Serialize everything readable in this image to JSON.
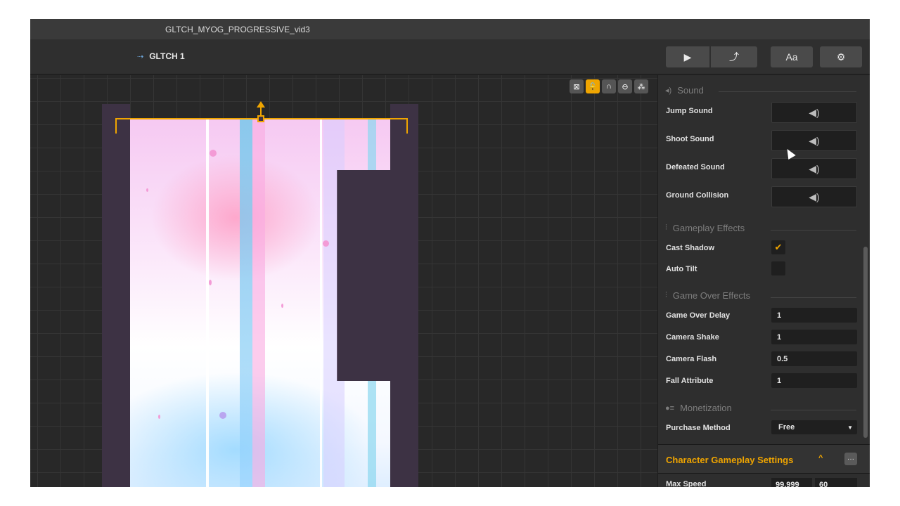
{
  "window": {
    "title": "GLTCH_MYOG_PROGRESSIVE_vid3"
  },
  "toolbar": {
    "scene_arrow": "⇢",
    "scene_name": "GLTCH 1",
    "play_icon": "▶",
    "share_icon": "⤴",
    "font_label": "Aa",
    "settings_icon": "⚙"
  },
  "canvas_tools": [
    "⊠",
    "🔓",
    "∩",
    "⊖",
    "⁂"
  ],
  "inspector": {
    "sound": {
      "header": "Sound",
      "icon": "◂)",
      "items": [
        {
          "label": "Jump Sound",
          "icon": "◀)"
        },
        {
          "label": "Shoot Sound",
          "icon": "◀)"
        },
        {
          "label": "Defeated Sound",
          "icon": "◀)"
        },
        {
          "label": "Ground Collision",
          "icon": "◀)"
        }
      ]
    },
    "gameplay_effects": {
      "header": "Gameplay Effects",
      "icon": "⫶",
      "cast_shadow": {
        "label": "Cast Shadow",
        "checked": true,
        "mark": "✔"
      },
      "auto_tilt": {
        "label": "Auto Tilt",
        "checked": false,
        "mark": ""
      }
    },
    "game_over_effects": {
      "header": "Game Over Effects",
      "icon": "⫶",
      "fields": [
        {
          "label": "Game Over Delay",
          "value": "1"
        },
        {
          "label": "Camera Shake",
          "value": "1"
        },
        {
          "label": "Camera Flash",
          "value": "0.5"
        },
        {
          "label": "Fall Attribute",
          "value": "1"
        }
      ]
    },
    "monetization": {
      "header": "Monetization",
      "icon": "●≡",
      "purchase_label": "Purchase Method",
      "purchase_value": "Free",
      "caret": "▼"
    },
    "character_settings": {
      "title": "Character Gameplay Settings",
      "chevron": "^",
      "more": "···",
      "max_speed_label": "Max Speed",
      "max_speed_a": "99.999",
      "max_speed_b": "60"
    }
  },
  "colors": {
    "accent": "#f0a500",
    "panel": "#2e2e2e",
    "canvas": "#282828",
    "sprite_dark": "#3d3244"
  }
}
